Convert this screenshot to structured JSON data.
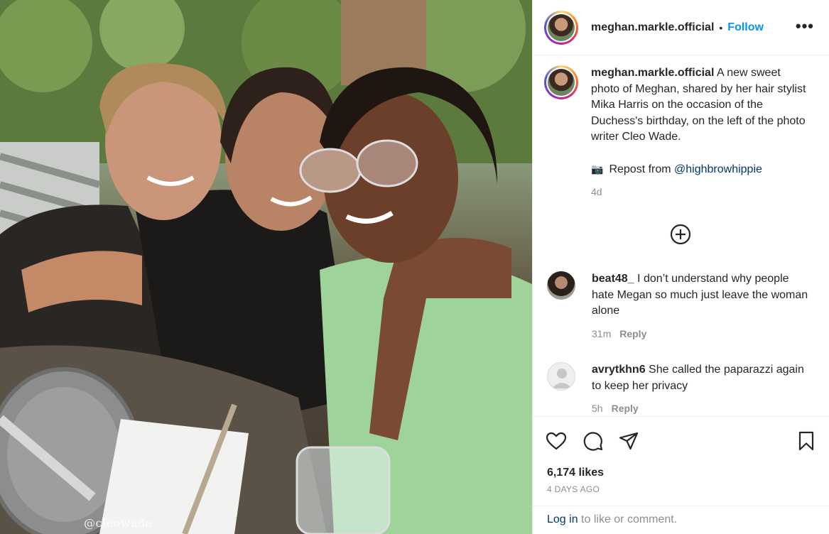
{
  "post": {
    "username": "meghan.markle.official",
    "separator": "•",
    "follow_label": "Follow",
    "more_label": "•••",
    "caption": "A new sweet photo of Meghan, shared by her hair stylist Mika Harris on the occasion of the Duchess's birthday, on the left of the photo writer Cleo Wade.",
    "repost_icon": "📷",
    "repost_prefix": "Repost from ",
    "repost_handle": "@highbrowhippie",
    "caption_time": "4d",
    "photo_watermark": "@cleowade"
  },
  "comments": [
    {
      "username": "beat48_",
      "text": "I don’t understand why people hate Megan so much just leave the woman alone",
      "time": "31m",
      "reply_label": "Reply"
    },
    {
      "username": "avrytkhn6",
      "text": "She called the paparazzi again to keep her privacy",
      "time": "5h",
      "reply_label": "Reply"
    }
  ],
  "actions": {
    "icons": [
      "heart-icon",
      "comment-icon",
      "share-icon",
      "bookmark-icon"
    ],
    "likes": "6,174 likes",
    "date": "4 DAYS AGO"
  },
  "footer": {
    "login_link": "Log in",
    "login_rest": " to like or comment."
  },
  "colors": {
    "accent": "#0095f6",
    "link": "#00376b",
    "muted": "#8e8e8e",
    "text": "#262626"
  }
}
